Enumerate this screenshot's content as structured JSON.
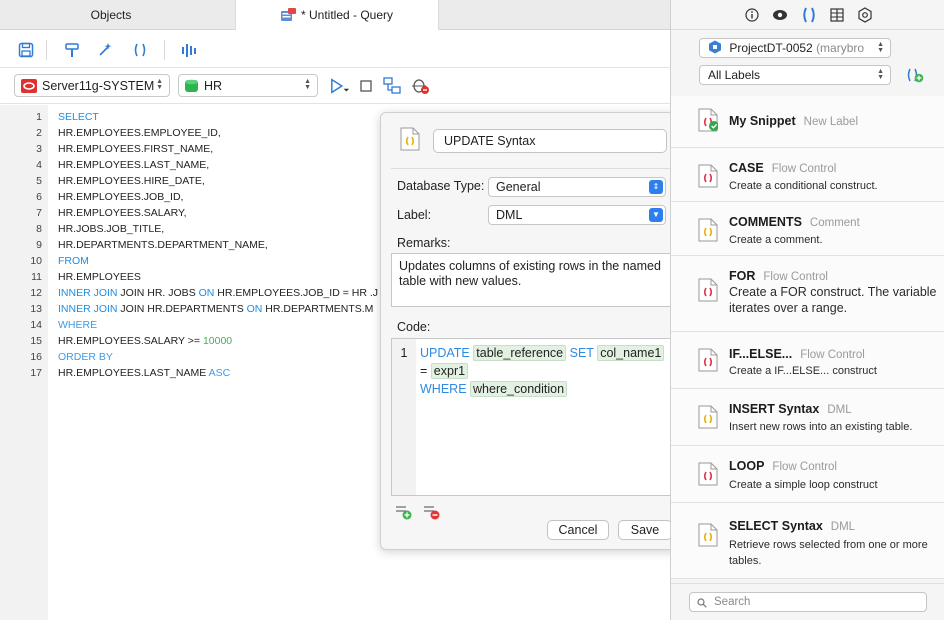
{
  "tabs": {
    "objects": "Objects",
    "query": "* Untitled - Query"
  },
  "connection": {
    "server": "Server11g-SYSTEM",
    "schema": "HR"
  },
  "editor": {
    "lines": [
      {
        "num": "1",
        "parts": [
          {
            "t": "SELECT",
            "c": "kw"
          }
        ]
      },
      {
        "num": "2",
        "parts": [
          {
            "t": "HR.EMPLOYEES.EMPLOYEE_ID,",
            "c": ""
          }
        ]
      },
      {
        "num": "3",
        "parts": [
          {
            "t": "HR.EMPLOYEES.FIRST_NAME,",
            "c": ""
          }
        ]
      },
      {
        "num": "4",
        "parts": [
          {
            "t": "HR.EMPLOYEES.LAST_NAME,",
            "c": ""
          }
        ]
      },
      {
        "num": "5",
        "parts": [
          {
            "t": "HR.EMPLOYEES.HIRE_DATE,",
            "c": ""
          }
        ]
      },
      {
        "num": "6",
        "parts": [
          {
            "t": "HR.EMPLOYEES.JOB_ID,",
            "c": ""
          }
        ]
      },
      {
        "num": "7",
        "parts": [
          {
            "t": "HR.EMPLOYEES.SALARY,",
            "c": ""
          }
        ]
      },
      {
        "num": "8",
        "parts": [
          {
            "t": "HR.JOBS.JOB_TITLE,",
            "c": ""
          }
        ]
      },
      {
        "num": "9",
        "parts": [
          {
            "t": "HR.DEPARTMENTS.DEPARTMENT_NAME,",
            "c": ""
          }
        ]
      },
      {
        "num": "10",
        "parts": [
          {
            "t": "FROM",
            "c": "kw"
          }
        ]
      },
      {
        "num": "11",
        "parts": [
          {
            "t": "HR.EMPLOYEES",
            "c": ""
          }
        ]
      },
      {
        "num": "12",
        "parts": [
          {
            "t": "INNER JOIN",
            "c": "kw"
          },
          {
            "t": " JOIN HR. JOBS ",
            "c": ""
          },
          {
            "t": "ON",
            "c": "kw"
          },
          {
            "t": " HR.EMPLOYEES.JOB_ID = HR .J",
            "c": ""
          }
        ]
      },
      {
        "num": "13",
        "parts": [
          {
            "t": "INNER JOIN",
            "c": "kw"
          },
          {
            "t": " JOIN HR.DEPARTMENTS ",
            "c": ""
          },
          {
            "t": "ON",
            "c": "kw"
          },
          {
            "t": " HR.DEPARTMENTS.M",
            "c": ""
          }
        ]
      },
      {
        "num": "14",
        "parts": [
          {
            "t": "WHERE",
            "c": "kw2"
          }
        ]
      },
      {
        "num": "15",
        "parts": [
          {
            "t": "HR.EMPLOYEES.SALARY >= ",
            "c": ""
          },
          {
            "t": "10000",
            "c": "num"
          }
        ]
      },
      {
        "num": "16",
        "parts": [
          {
            "t": "ORDER BY",
            "c": "kw2"
          }
        ]
      },
      {
        "num": "17",
        "parts": [
          {
            "t": "HR.EMPLOYEES.LAST_NAME ",
            "c": ""
          },
          {
            "t": "ASC",
            "c": "kw2"
          }
        ]
      }
    ]
  },
  "popover": {
    "snippet_name": "UPDATE Syntax",
    "database_type_label": "Database Type:",
    "database_type_value": "General",
    "label_label": "Label:",
    "label_value": "DML",
    "remarks_label": "Remarks:",
    "remarks_text": "Updates columns of existing rows in the named table with new values.",
    "code_label": "Code:",
    "code_line_number": "1",
    "code": {
      "update": "UPDATE",
      "table_reference": "table_reference",
      "set": "SET",
      "col_name1": "col_name1",
      "eq": "=",
      "expr1": "expr1",
      "where": "WHERE",
      "where_condition": "where_condition"
    },
    "cancel_label": "Cancel",
    "save_label": "Save"
  },
  "right_panel": {
    "project": "ProjectDT-0052",
    "project_owner": "(marybro",
    "labels_filter": "All Labels",
    "search_placeholder": "Search",
    "snippets": [
      {
        "title": "My Snippet",
        "label": "New Label",
        "desc": "",
        "icon_color": "#e0324b",
        "check": true
      },
      {
        "title": "CASE",
        "label": "Flow Control",
        "desc": "Create a conditional construct.",
        "icon_color": "#e0324b",
        "check": false
      },
      {
        "title": "COMMENTS",
        "label": "Comment",
        "desc": "Create a comment.",
        "icon_color": "#e6b400",
        "check": false
      },
      {
        "title": "FOR",
        "label": "Flow Control",
        "desc": "Create a FOR construct. The variable iterates over a range.",
        "icon_color": "#e0324b",
        "check": false
      },
      {
        "title": "IF...ELSE...",
        "label": "Flow Control",
        "desc": "Create a IF...ELSE... construct",
        "icon_color": "#e0324b",
        "check": false
      },
      {
        "title": "INSERT Syntax",
        "label": "DML",
        "desc": "Insert new rows into an existing table.",
        "icon_color": "#e6b400",
        "check": false
      },
      {
        "title": "LOOP",
        "label": "Flow Control",
        "desc": "Create a simple loop construct",
        "icon_color": "#e0324b",
        "check": false
      },
      {
        "title": "SELECT Syntax",
        "label": "DML",
        "desc": "Retrieve rows selected from one or more tables.",
        "icon_color": "#e6b400",
        "check": false
      }
    ]
  }
}
